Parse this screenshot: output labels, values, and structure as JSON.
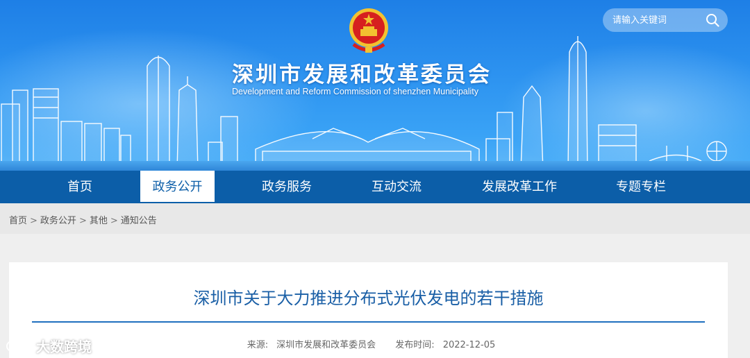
{
  "header": {
    "title": "深圳市发展和改革委员会",
    "subtitle": "Development and Reform Commission of shenzhen Municipality",
    "search_placeholder": "请输入关键词"
  },
  "nav": {
    "items": [
      {
        "label": "首页"
      },
      {
        "label": "政务公开"
      },
      {
        "label": "政务服务"
      },
      {
        "label": "互动交流"
      },
      {
        "label": "发展改革工作"
      },
      {
        "label": "专题专栏"
      }
    ],
    "active_index": 1
  },
  "breadcrumb": {
    "items": [
      "首页",
      "政务公开",
      "其他",
      "通知公告"
    ],
    "separator": ">"
  },
  "article": {
    "title": "深圳市关于大力推进分布式光伏发电的若干措施",
    "source_label": "来源:",
    "source": "深圳市发展和改革委员会",
    "date_label": "发布时间:",
    "date": "2022-12-05"
  },
  "watermark": {
    "text": "大数跨境"
  },
  "colors": {
    "banner_blue": "#2d93f0",
    "nav_blue": "#0c5ea8",
    "title_blue": "#1a5fa6",
    "emblem_red": "#d6201f",
    "emblem_gold": "#f2c230"
  }
}
